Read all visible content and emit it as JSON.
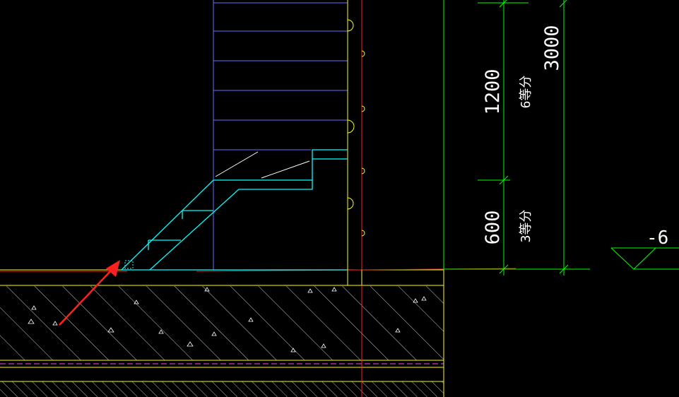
{
  "dimensions": {
    "upper_length": "1200",
    "upper_division": "6等分",
    "lower_length": "600",
    "lower_division": "3等分",
    "total_length": "3000"
  },
  "elevation_marker": "-6",
  "colors": {
    "background": "#000000",
    "dimension_lines": "#00ff00",
    "stair": "#00ffff",
    "wall_lines": "#ffff00",
    "guide_lines": "#6c6cff",
    "axis_line": "#ff2020",
    "arrow": "#ff2020",
    "hatch": "#ffffff",
    "dashed_line": "#ff40ff"
  }
}
